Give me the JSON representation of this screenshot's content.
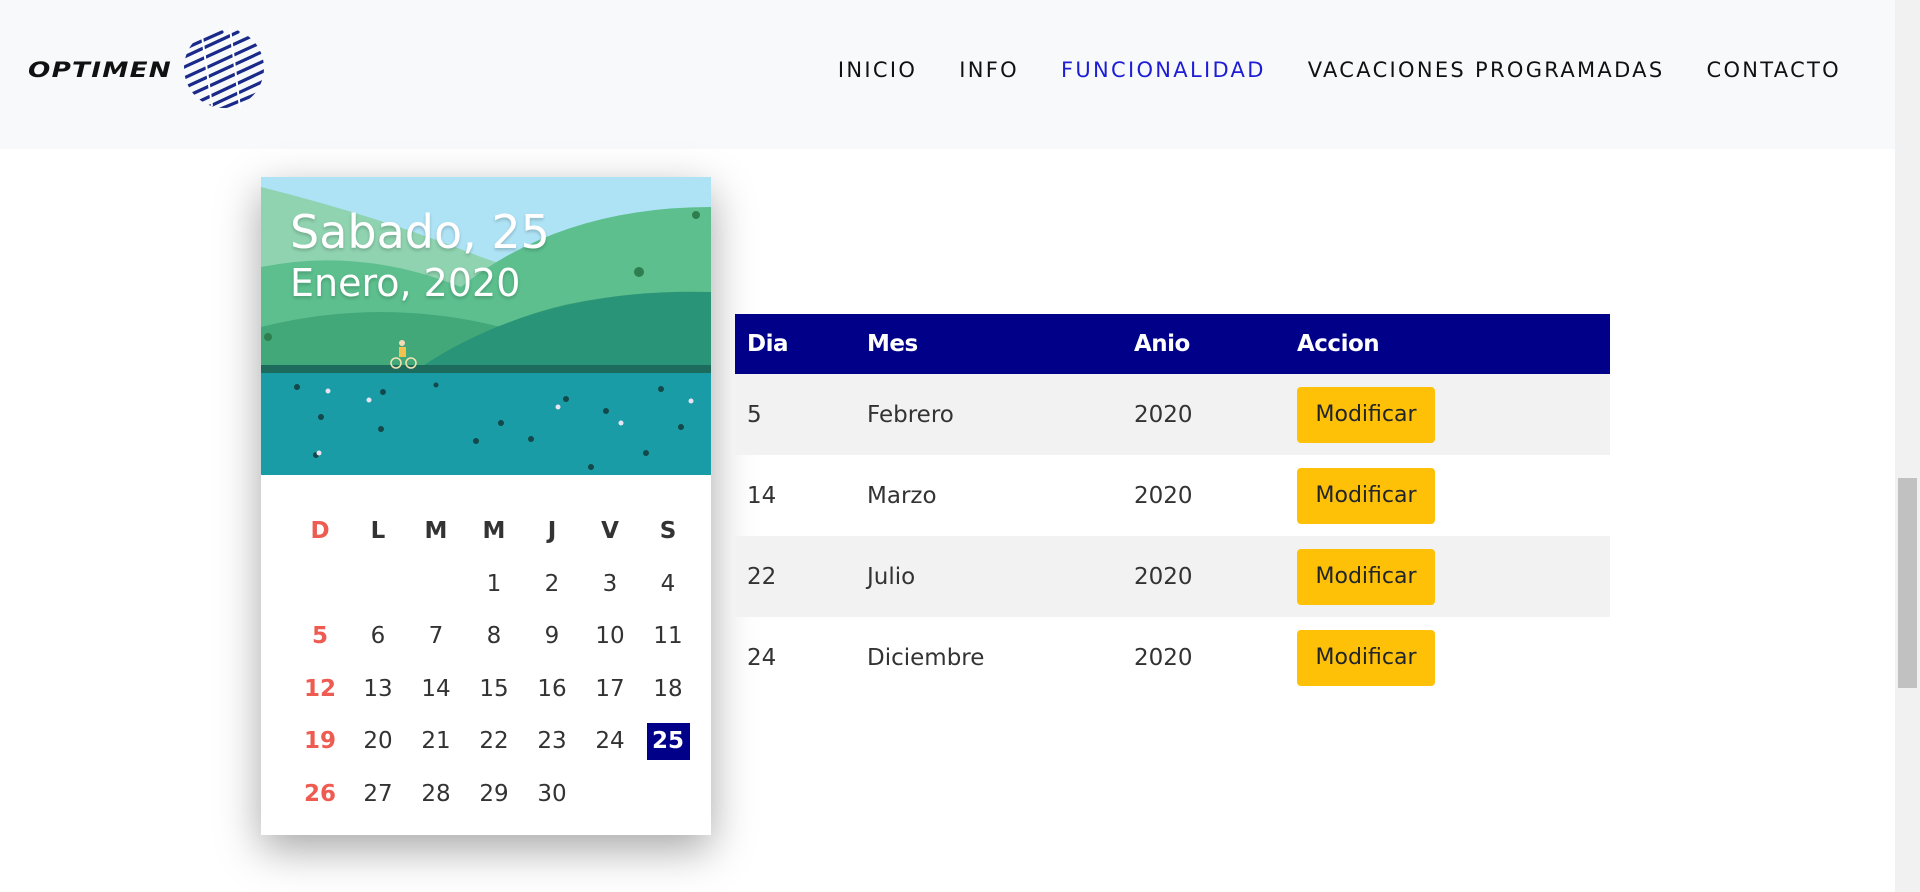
{
  "brand": {
    "logo_text": "OPTIMEN",
    "logo_icon": "globe-lines-icon"
  },
  "nav": {
    "items": [
      "INICIO",
      "INFO",
      "FUNCIONALIDAD",
      "VACACIONES PROGRAMADAS",
      "CONTACTO"
    ],
    "active": "FUNCIONALIDAD",
    "active_color": "#1d1dd7"
  },
  "calendar": {
    "day_label": "Sabado, 25",
    "month_label": "Enero, 2020",
    "weekdays": [
      "D",
      "L",
      "M",
      "M",
      "J",
      "V",
      "S"
    ],
    "first_weekday_index": 3,
    "days_in_month": 30,
    "selected_day": 25,
    "sunday_color": "#ee5b50",
    "selected_color": "#000088"
  },
  "table": {
    "headers": [
      "Dia",
      "Mes",
      "Anio",
      "Accion"
    ],
    "rows": [
      {
        "dia": "5",
        "mes": "Febrero",
        "anio": "2020",
        "accion": "Modificar"
      },
      {
        "dia": "14",
        "mes": "Marzo",
        "anio": "2020",
        "accion": "Modificar"
      },
      {
        "dia": "22",
        "mes": "Julio",
        "anio": "2020",
        "accion": "Modificar"
      },
      {
        "dia": "24",
        "mes": "Diciembre",
        "anio": "2020",
        "accion": "Modificar"
      }
    ],
    "header_color": "#000088",
    "button_color": "#ffc107"
  }
}
